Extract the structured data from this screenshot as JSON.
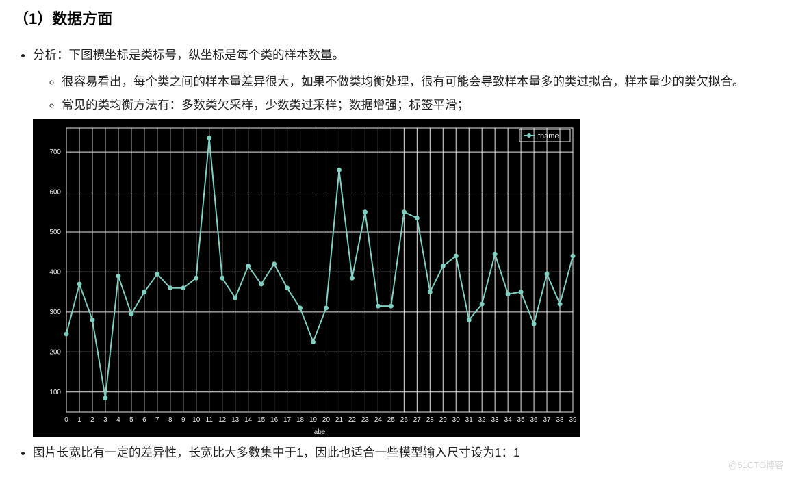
{
  "heading": "（1）数据方面",
  "bullets": {
    "analysis": "分析：下图横坐标是类标号，纵坐标是每个类的样本数量。",
    "sub1": "很容易看出，每个类之间的样本量差异很大，如果不做类均衡处理，很有可能会导致样本量多的类过拟合，样本量少的类欠拟合。",
    "sub2": "常见的类均衡方法有：多数类欠采样，少数类过采样；数据增强；标签平滑；",
    "ratio": "图片长宽比有一定的差异性，长宽比大多数集中于1，因此也适合一些模型输入尺寸设为1：1"
  },
  "watermark": "@51CTO博客",
  "chart_data": {
    "type": "line",
    "title": "",
    "xlabel": "label",
    "ylabel": "",
    "legend": "fname",
    "x": [
      0,
      1,
      2,
      3,
      4,
      5,
      6,
      7,
      8,
      9,
      10,
      11,
      12,
      13,
      14,
      15,
      16,
      17,
      18,
      19,
      20,
      21,
      22,
      23,
      24,
      25,
      26,
      27,
      28,
      29,
      30,
      31,
      32,
      33,
      34,
      35,
      36,
      37,
      38,
      39
    ],
    "y": [
      245,
      370,
      280,
      85,
      390,
      295,
      350,
      395,
      360,
      360,
      385,
      735,
      385,
      335,
      415,
      370,
      420,
      360,
      310,
      225,
      310,
      655,
      385,
      550,
      315,
      315,
      550,
      535,
      350,
      415,
      440,
      280,
      320,
      445,
      345,
      350,
      270,
      395,
      320,
      440
    ],
    "y_ticks": [
      100,
      200,
      300,
      400,
      500,
      600,
      700
    ],
    "xlim": [
      0,
      39
    ],
    "ylim": [
      50,
      760
    ]
  }
}
